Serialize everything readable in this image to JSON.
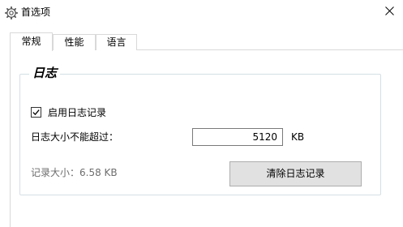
{
  "window": {
    "title": "首选项",
    "icon": "gear-icon",
    "close_icon": "close-icon"
  },
  "tabs": [
    {
      "label": "常规",
      "active": true
    },
    {
      "label": "性能",
      "active": false
    },
    {
      "label": "语言",
      "active": false
    }
  ],
  "log_group": {
    "title": "日志",
    "enable_label": "启用日志记录",
    "enable_checked": true,
    "max_size_label": "日志大小不能超过：",
    "max_size_value": "5120",
    "max_size_unit": "KB",
    "usage_text": "记录大小：6.58 KB",
    "clear_button": "清除日志记录"
  }
}
